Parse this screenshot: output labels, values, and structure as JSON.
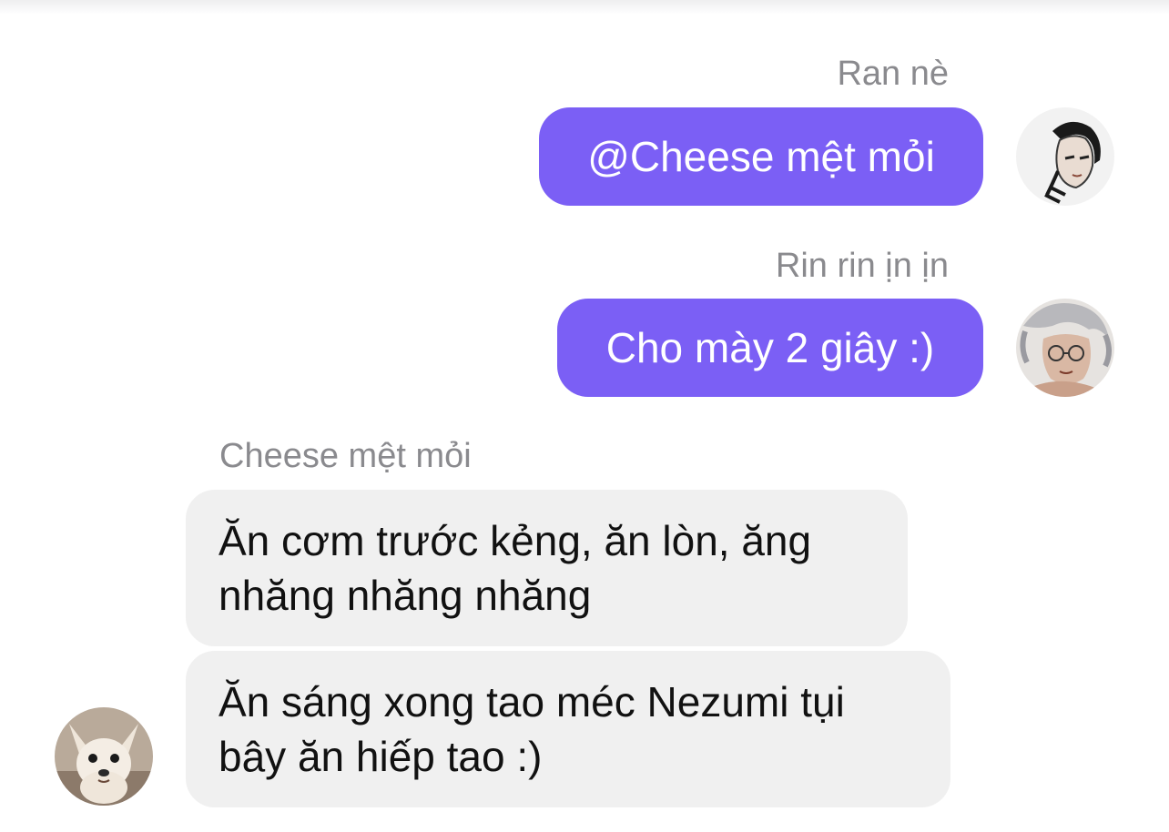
{
  "messages": [
    {
      "sender": "Ran nè",
      "text": "@Cheese mệt mỏi",
      "direction": "outgoing",
      "avatar_icon": "anime-character-braid-avatar-icon"
    },
    {
      "sender": "Rin rin ịn ịn",
      "text": "Cho mày 2 giây :)",
      "direction": "outgoing",
      "avatar_icon": "anime-character-glasses-avatar-icon"
    },
    {
      "sender": "Cheese mệt mỏi",
      "text": "Ăn cơm trước kẻng, ăn lòn, ăng nhăng nhăng nhăng",
      "direction": "incoming"
    },
    {
      "text": "Ăn sáng xong tao méc Nezumi tụi bây ăn hiếp tao :)",
      "direction": "incoming",
      "avatar_icon": "chihuahua-dog-avatar-icon"
    }
  ],
  "colors": {
    "outgoing_bubble": "#7b5ff5",
    "incoming_bubble": "#f0f0f0",
    "sender_name": "#8a8a8e"
  }
}
